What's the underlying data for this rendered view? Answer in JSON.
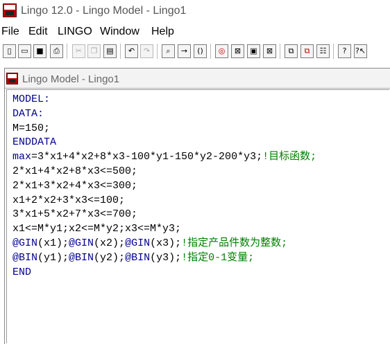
{
  "app": {
    "title": "Lingo 12.0 - Lingo Model - Lingo1"
  },
  "menu": [
    "File",
    "Edit",
    "LINGO",
    "Window",
    "Help"
  ],
  "toolbar": {
    "icons": [
      "new-file-icon",
      "open-file-icon",
      "save-icon",
      "print-icon",
      "cut-icon",
      "copy-icon",
      "paste-icon",
      "undo-icon",
      "redo-icon",
      "find-icon",
      "goto-line-icon",
      "match-parenthesis-icon",
      "solve-icon",
      "solution-icon",
      "matrix-picture-icon",
      "close-all-icon",
      "tile-icon",
      "send-to-back-icon",
      "options-icon",
      "help-icon",
      "context-help-icon"
    ]
  },
  "window": {
    "title": "Lingo Model - Lingo1"
  },
  "editor": {
    "lines": [
      {
        "code": "MODEL:",
        "comment": "",
        "kw": true
      },
      {
        "code": "DATA:",
        "comment": "",
        "kw": true
      },
      {
        "code": "M=150;",
        "comment": "",
        "kw": false
      },
      {
        "code": "ENDDATA",
        "comment": "",
        "kw": true
      },
      {
        "code": "max=3*x1+4*x2+8*x3-100*y1-150*y2-200*y3;",
        "comment": "!目标函数;",
        "kw": false
      },
      {
        "code": "2*x1+4*x2+8*x3<=500;",
        "comment": "",
        "kw": false
      },
      {
        "code": "2*x1+3*x2+4*x3<=300;",
        "comment": "",
        "kw": false
      },
      {
        "code": "x1+2*x2+3*x3<=100;",
        "comment": "",
        "kw": false
      },
      {
        "code": "3*x1+5*x2+7*x3<=700;",
        "comment": "",
        "kw": false
      },
      {
        "code": "x1<=M*y1;x2<=M*y2;x3<=M*y3;",
        "comment": "",
        "kw": false
      },
      {
        "code": "@GIN(x1);@GIN(x2);@GIN(x3);",
        "comment": "!指定产品件数为整数;",
        "kw": false
      },
      {
        "code": "@BIN(y1);@BIN(y2);@BIN(y3);",
        "comment": "!指定0-1变量;",
        "kw": false
      },
      {
        "code": "END",
        "comment": "",
        "kw": true
      }
    ]
  }
}
